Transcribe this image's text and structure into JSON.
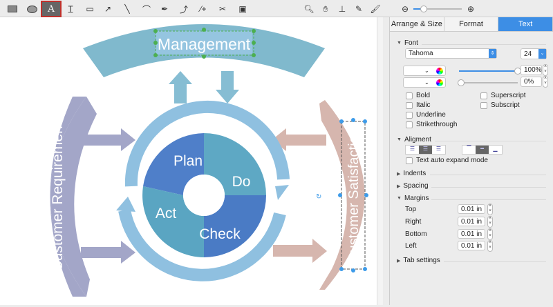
{
  "toolbar": {
    "tools": [
      "rectangle-tool",
      "ellipse-tool",
      "text-tool",
      "text-box-tool",
      "callout-tool",
      "arrow-tool",
      "line-tool",
      "arc-tool",
      "pen-tool",
      "bezier-tool",
      "add-point-tool",
      "cut-tool",
      "container-tool"
    ],
    "text_tool_glyph": "A",
    "view_tools": [
      "zoom-tool",
      "pan-tool",
      "stamp-tool",
      "eyedropper-tool",
      "format-painter-tool"
    ],
    "zoom_fraction": 0.2
  },
  "diagram": {
    "top": "Management",
    "left": "Customer Requirement",
    "right": "Customer Satisfaction",
    "cycle": [
      "Plan",
      "Do",
      "Check",
      "Act"
    ]
  },
  "panel": {
    "tabs": [
      "Arrange & Size",
      "Format",
      "Text"
    ],
    "active_tab": "Text",
    "font": {
      "title": "Font",
      "family": "Tahoma",
      "size": "24",
      "opacity1": "100%",
      "opacity2": "0%",
      "options_left": [
        "Bold",
        "Italic",
        "Underline",
        "Strikethrough"
      ],
      "options_right": [
        "Superscript",
        "Subscript"
      ]
    },
    "alignment": {
      "title": "Aligment",
      "auto_expand": "Text auto expand mode"
    },
    "indents": "Indents",
    "spacing": "Spacing",
    "margins": {
      "title": "Margins",
      "rows": [
        {
          "label": "Top",
          "value": "0.01 in"
        },
        {
          "label": "Right",
          "value": "0.01 in"
        },
        {
          "label": "Bottom",
          "value": "0.01 in"
        },
        {
          "label": "Left",
          "value": "0.01 in"
        }
      ]
    },
    "tab_settings": "Tab settings"
  },
  "colors": {
    "accent": "#3d8ee5",
    "management": "#80b9cd",
    "requirement": "#a3a6c8",
    "satisfaction": "#d6b6ae",
    "ring": "#8fc0e0",
    "plan": "#4f7fc9",
    "do": "#5ea8c4"
  }
}
